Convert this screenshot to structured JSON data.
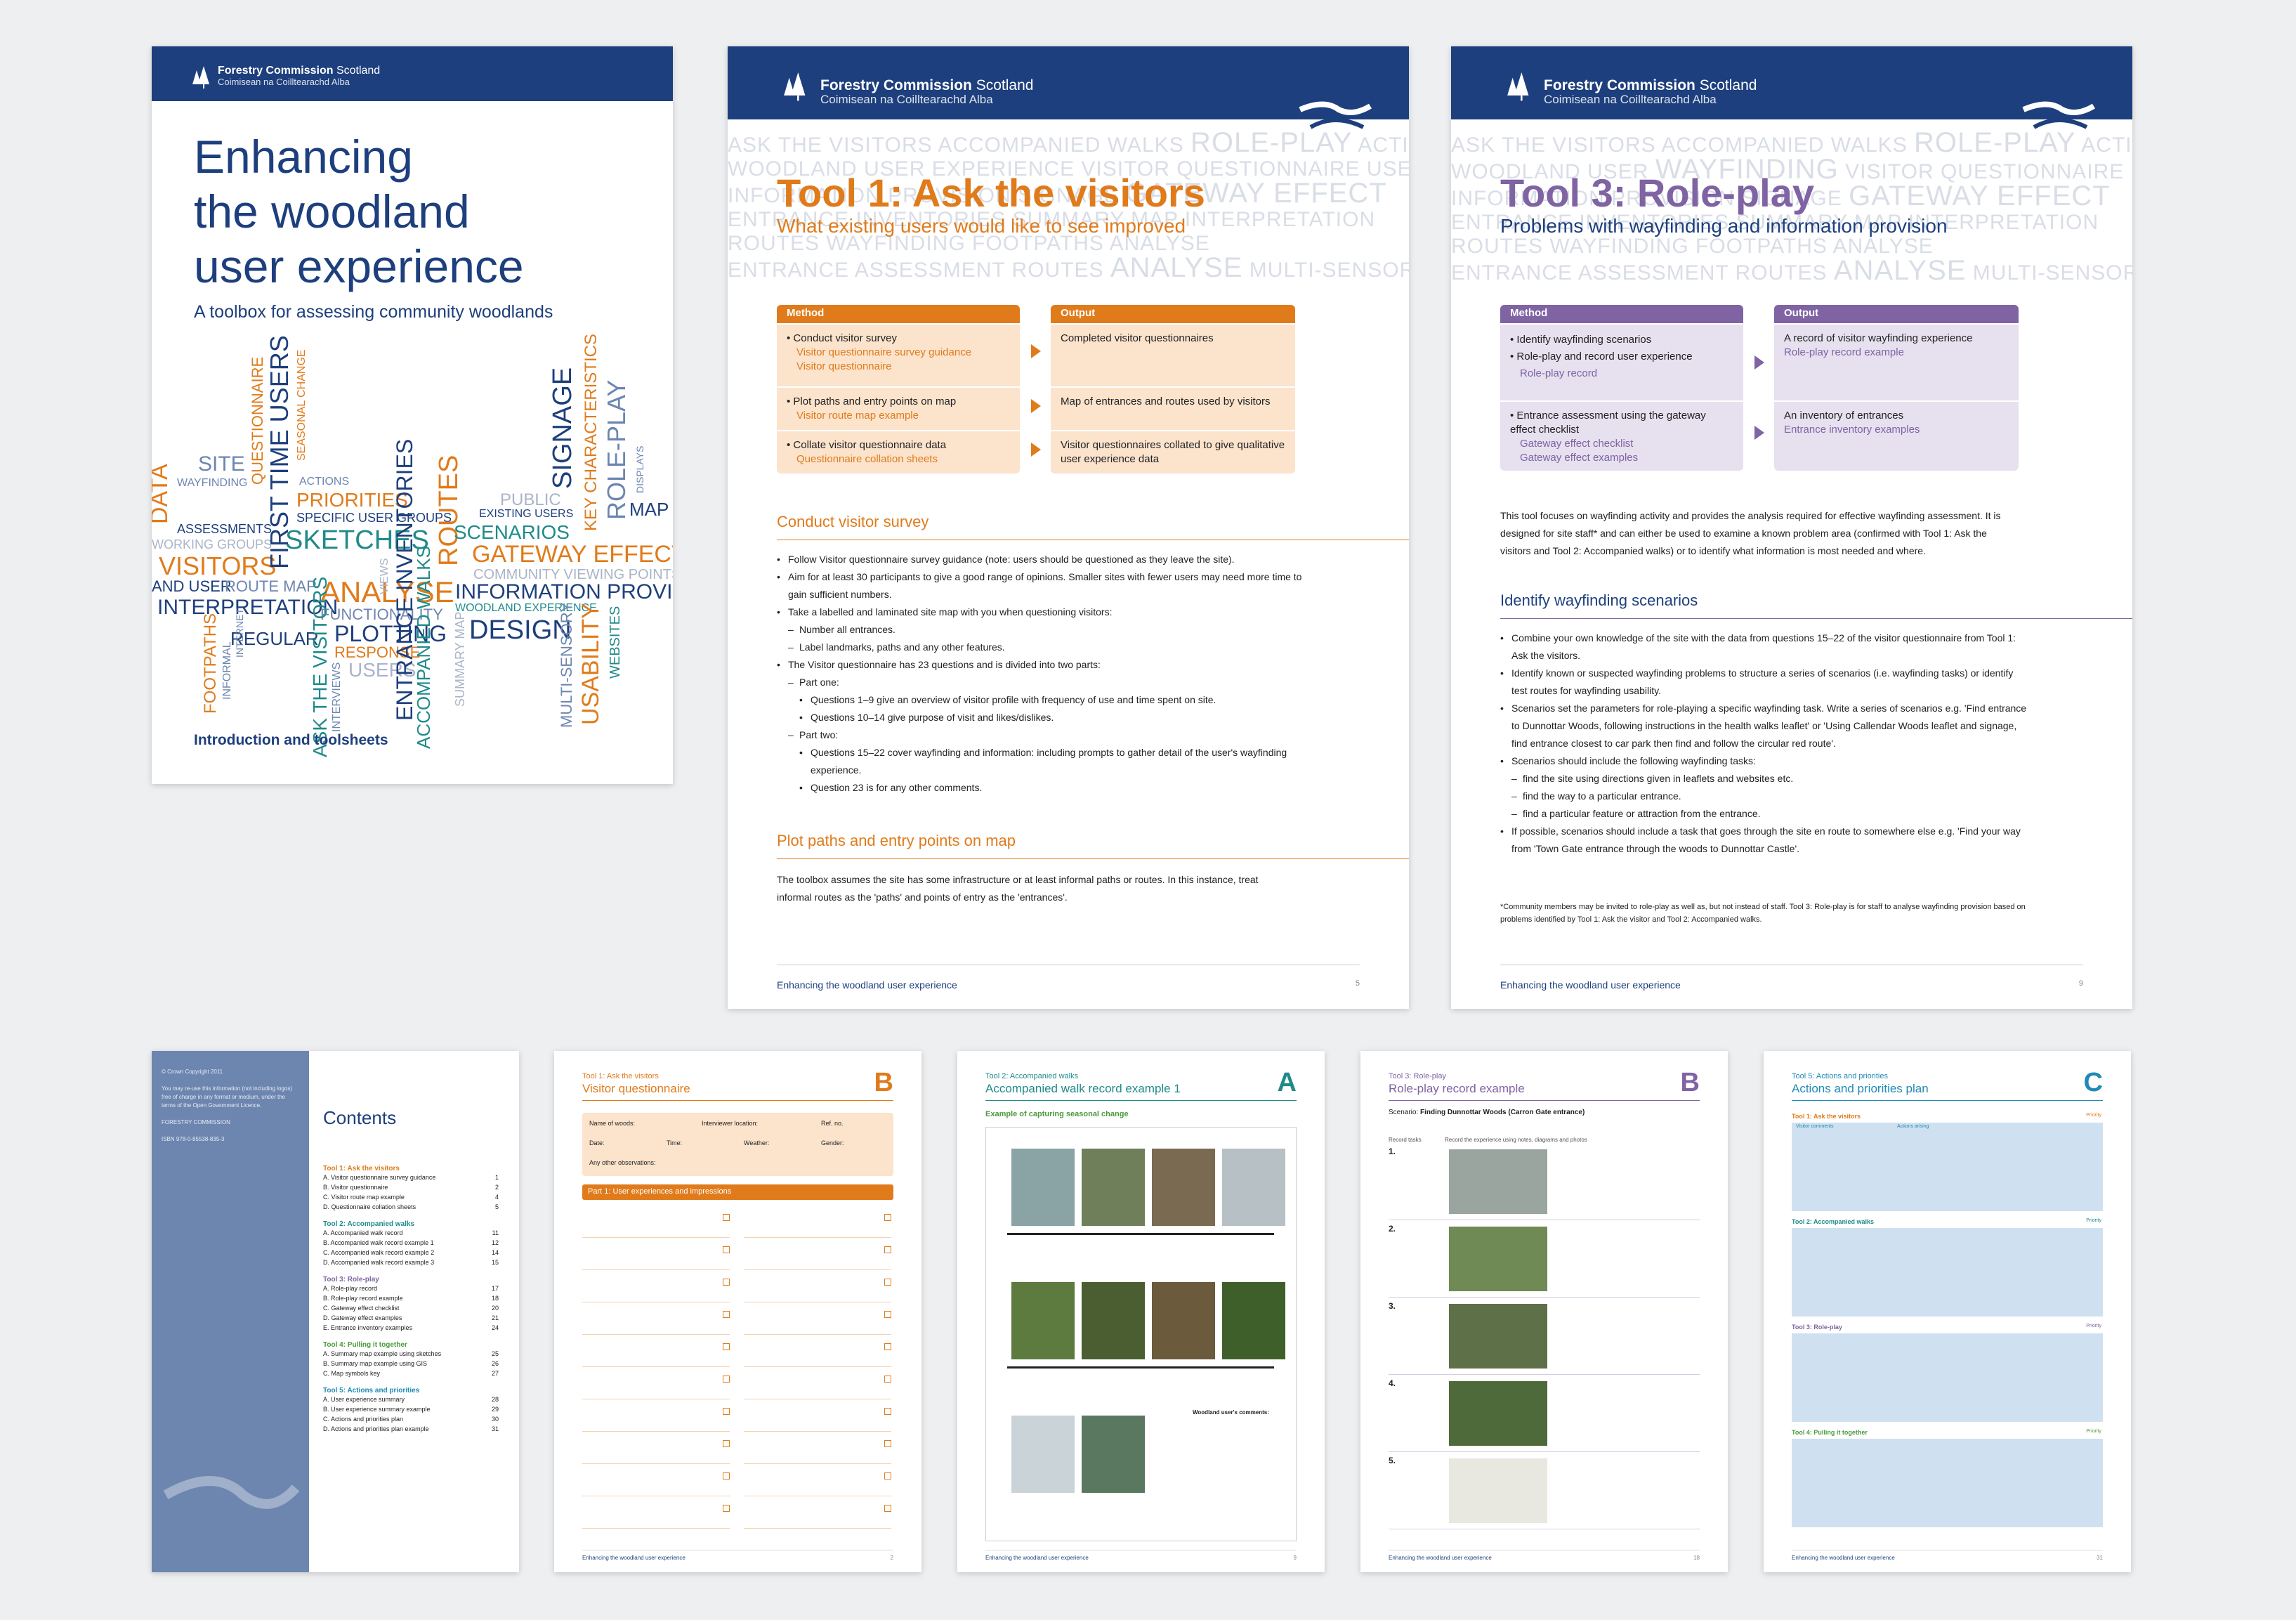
{
  "brand": {
    "name": "Forestry Commission",
    "region": "Scotland",
    "gaelic": "Coimisean na Coilltearachd",
    "gaelic2": "Alba"
  },
  "cover": {
    "title_lines": [
      "Enhancing",
      "the woodland",
      "user experience"
    ],
    "subtitle": "A toolbox for assessing community woodlands",
    "footer": "Introduction and toolsheets",
    "words": [
      "SITE",
      "WAYFINDING",
      "DATA",
      "ASSESSMENTS",
      "WORKING GROUPS",
      "VISITORS",
      "AND USER",
      "ROUTE MAP",
      "INTERPRETATION",
      "QUESTIONNAIRE",
      "FIRST TIME USERS",
      "SEASONAL CHANGE",
      "ACTIONS",
      "PRIORITIES",
      "SPECIFIC USER GROUPS",
      "SKETCHES",
      "ANALYSE",
      "FUNCTIONALITY",
      "PLOTTING",
      "RESPONSE",
      "USERS",
      "REGULAR",
      "FOOTPATHS",
      "INFORMAL",
      "INTERNET",
      "ASK THE VISITORS",
      "INTERVIEWS",
      "VIEWS",
      "ENTRANCE INVENTORIES",
      "ROUTES",
      "ACCOMPANIED WALKS",
      "SUMMARY MAP",
      "PUBLIC",
      "EXISTING USERS",
      "SCENARIOS",
      "GATEWAY EFFECT",
      "COMMUNITY VIEWING POINTS",
      "INFORMATION PROVISION",
      "WOODLAND EXPERIENCE",
      "DESIGN",
      "MULTI-SENSORY",
      "USABILITY",
      "WEBSITES",
      "SIGNAGE",
      "KEY CHARACTERISTICS",
      "ROLE-PLAY",
      "MAP",
      "DISPLAYS"
    ]
  },
  "tool1": {
    "title": "Tool 1: Ask the visitors",
    "subtitle": "What existing users would like to see improved",
    "method_label": "Method",
    "output_label": "Output",
    "rows": [
      {
        "method": "Conduct visitor survey",
        "links": [
          "Visitor questionnaire survey guidance",
          "Visitor questionnaire"
        ],
        "output": "Completed visitor questionnaires"
      },
      {
        "method": "Plot paths and entry points on map",
        "links": [
          "Visitor route map example"
        ],
        "output": "Map of entrances and routes used by visitors"
      },
      {
        "method": "Collate visitor questionnaire data",
        "links": [
          "Questionnaire collation sheets"
        ],
        "output": "Visitor questionnaires collated to give qualitative user experience data"
      }
    ],
    "section1": "Conduct visitor survey",
    "bullets1": [
      {
        "t": "Follow Visitor questionnaire survey guidance (note: users should be questioned as they leave the site).",
        "lvl": 0
      },
      {
        "t": "Aim for at least 30 participants to give a good range of opinions. Smaller sites with fewer users may need more time to gain sufficient numbers.",
        "lvl": 0
      },
      {
        "t": "Take a labelled and laminated site map with you when questioning visitors:",
        "lvl": 0
      },
      {
        "t": "Number all entrances.",
        "lvl": 1
      },
      {
        "t": "Label landmarks, paths and any other features.",
        "lvl": 1
      },
      {
        "t": "The Visitor questionnaire has 23 questions and is divided into two parts:",
        "lvl": 0
      },
      {
        "t": "Part one:",
        "lvl": 1
      },
      {
        "t": "Questions 1–9 give an overview of visitor profile with frequency of use and time spent on site.",
        "lvl": 2
      },
      {
        "t": "Questions 10–14 give purpose of visit and likes/dislikes.",
        "lvl": 2
      },
      {
        "t": "Part two:",
        "lvl": 1
      },
      {
        "t": "Questions 15–22 cover wayfinding and information: including prompts to gather detail of the user's wayfinding experience.",
        "lvl": 2
      },
      {
        "t": "Question 23 is for any other comments.",
        "lvl": 2
      }
    ],
    "section2": "Plot paths and entry points on map",
    "para2": "The toolbox assumes the site has some infrastructure or at least informal paths or routes. In this instance, treat informal routes as the 'paths' and points of entry as the 'entrances'.",
    "footer": "Enhancing the woodland user experience",
    "page": "5"
  },
  "tool3": {
    "title": "Tool 3: Role-play",
    "subtitle": "Problems with wayfinding and information provision",
    "method_label": "Method",
    "output_label": "Output",
    "rows": [
      {
        "method": [
          "Identify wayfinding scenarios",
          "Role-play and record user experience"
        ],
        "links": [
          "Role-play record"
        ],
        "output": "A record of visitor wayfinding experience",
        "olinks": [
          "Role-play record example"
        ]
      },
      {
        "method": [
          "Entrance assessment using the gateway effect checklist"
        ],
        "links": [
          "Gateway effect checklist",
          "Gateway effect examples"
        ],
        "output": "An inventory of entrances",
        "olinks": [
          "Entrance inventory examples"
        ]
      }
    ],
    "intro": "This tool focuses on wayfinding activity and provides the analysis required for effective wayfinding assessment. It is designed for site staff* and can either be used to examine a known problem area (confirmed with Tool 1: Ask the visitors and Tool 2: Accompanied walks) or to identify what information is most needed and where.",
    "section1": "Identify wayfinding scenarios",
    "bullets": [
      {
        "t": "Combine your own knowledge of the site with the data from questions 15–22 of the visitor questionnaire from Tool 1: Ask the visitors.",
        "lvl": 0
      },
      {
        "t": "Identify known or suspected wayfinding problems to structure a series of scenarios (i.e. wayfinding tasks) or identify test routes for wayfinding usability.",
        "lvl": 0
      },
      {
        "t": "Scenarios set the parameters for role-playing a specific wayfinding task. Write a series of scenarios e.g. 'Find entrance to Dunnottar Woods, following instructions in the health walks leaflet' or 'Using Callendar Woods leaflet and signage, find entrance closest to car park then find and follow the circular red route'.",
        "lvl": 0
      },
      {
        "t": "Scenarios should include the following wayfinding tasks:",
        "lvl": 0
      },
      {
        "t": "find the site using directions given in leaflets and websites etc.",
        "lvl": 1
      },
      {
        "t": "find the way to a particular entrance.",
        "lvl": 1
      },
      {
        "t": "find a particular feature or attraction from the entrance.",
        "lvl": 1
      },
      {
        "t": "If possible, scenarios should include a task that goes through the site en route to somewhere else e.g. 'Find your way from 'Town Gate entrance through the woods to Dunnottar Castle'.",
        "lvl": 0
      }
    ],
    "footnote": "*Community members may be invited to role-play as well as, but not instead of staff. Tool 3: Role-play is for staff to analyse wayfinding provision based on problems identified by Tool 1: Ask the visitor and Tool 2: Accompanied walks.",
    "footer": "Enhancing the woodland user experience",
    "page": "9"
  },
  "contents": {
    "title": "Contents",
    "groups": [
      {
        "h": "Tool 1: Ask the visitors",
        "items": [
          [
            "A. Visitor questionnaire survey guidance",
            "1"
          ],
          [
            "B. Visitor questionnaire",
            "2"
          ],
          [
            "C. Visitor route map example",
            "4"
          ],
          [
            "D. Questionnaire collation sheets",
            "5"
          ]
        ]
      },
      {
        "h": "Tool 2: Accompanied walks",
        "items": [
          [
            "A. Accompanied walk record",
            "11"
          ],
          [
            "B. Accompanied walk record example 1",
            "12"
          ],
          [
            "C. Accompanied walk record example 2",
            "14"
          ],
          [
            "D. Accompanied walk record example 3",
            "15"
          ]
        ]
      },
      {
        "h": "Tool 3: Role-play",
        "items": [
          [
            "A. Role-play record",
            "17"
          ],
          [
            "B. Role-play record example",
            "18"
          ],
          [
            "C. Gateway effect checklist",
            "20"
          ],
          [
            "D. Gateway effect examples",
            "21"
          ],
          [
            "E. Entrance inventory examples",
            "24"
          ]
        ]
      },
      {
        "h": "Tool 4: Pulling it together",
        "items": [
          [
            "A. Summary map example using sketches",
            "25"
          ],
          [
            "B. Summary map example using GIS",
            "26"
          ],
          [
            "C. Map symbols key",
            "27"
          ]
        ]
      },
      {
        "h": "Tool 5: Actions and priorities",
        "items": [
          [
            "A. User experience summary",
            "28"
          ],
          [
            "B. User experience summary example",
            "29"
          ],
          [
            "C. Actions and priorities plan",
            "30"
          ],
          [
            "D. Actions and priorities plan example",
            "31"
          ]
        ]
      }
    ],
    "side": [
      "© Crown Copyright 2011",
      "You may re-use this information (not including logos) free of charge in any format or medium, under the terms of the Open Government Licence.",
      "FORESTRY COMMISSION",
      "ISBN 978-0-85538-835-3"
    ]
  },
  "sheetB": {
    "tool": "Tool 1: Ask the visitors",
    "title": "Visitor questionnaire",
    "letter": "B",
    "part": "Part 1: User experiences and impressions",
    "fields": [
      "Name of woods:",
      "Interviewer location:",
      "Ref. no.",
      "Date:",
      "Time:",
      "Weather:",
      "Gender:",
      "Any other observations:"
    ],
    "footer": "Enhancing the woodland user experience",
    "page": "2"
  },
  "sheetA": {
    "tool": "Tool 2: Accompanied walks",
    "title": "Accompanied walk record example 1",
    "letter": "A",
    "caption": "Example of capturing seasonal change",
    "quote_title": "Woodland user's comments:",
    "footer": "Enhancing the woodland user experience",
    "page": "9"
  },
  "sheetRB": {
    "tool": "Tool 3: Role-play",
    "title": "Role-play record example",
    "letter": "B",
    "scenario_label": "Scenario:",
    "scenario": "Finding Dunnottar Woods (Carron Gate entrance)",
    "col1": "Record tasks",
    "col2": "Record the experience using notes, diagrams and photos",
    "steps": [
      "1.",
      "2.",
      "3.",
      "4.",
      "5."
    ],
    "footer": "Enhancing the woodland user experience",
    "page": "18"
  },
  "sheetC": {
    "tool": "Tool 5: Actions and priorities",
    "title": "Actions and priorities plan",
    "letter": "C",
    "cols": [
      "Visitor comments",
      "Actions arising",
      "Priority"
    ],
    "sections": [
      "Tool 1: Ask the visitors",
      "Tool 2: Accompanied walks",
      "Tool 3: Role-play",
      "Tool 4: Pulling it together"
    ],
    "footer": "Enhancing the woodland user experience",
    "page": "31"
  },
  "colors": {
    "navy": "#1d3f7d",
    "orange": "#e07b1b",
    "purple": "#7f63a3",
    "teal": "#1f8a8a",
    "green": "#4a9a3c",
    "slate": "#6d86b0"
  }
}
